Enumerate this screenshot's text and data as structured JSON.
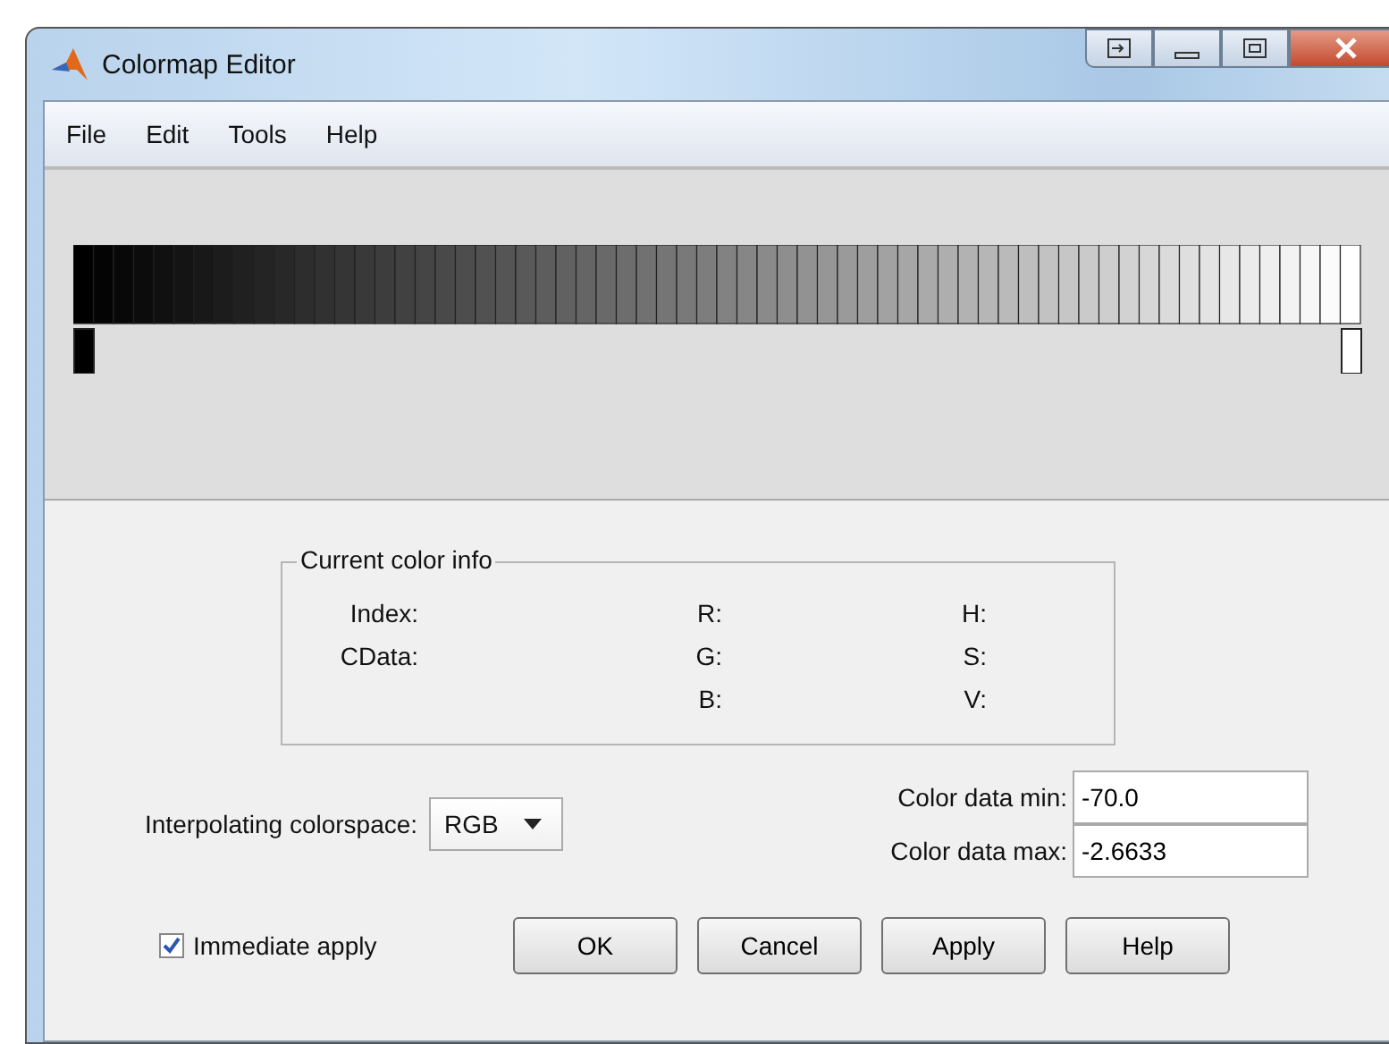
{
  "window": {
    "title": "Colormap Editor"
  },
  "menu": [
    "File",
    "Edit",
    "Tools",
    "Help"
  ],
  "color_info": {
    "title": "Current color info",
    "columns": [
      [
        "Index:",
        "CData:"
      ],
      [
        "R:",
        "G:",
        "B:"
      ],
      [
        "H:",
        "S:",
        "V:"
      ]
    ]
  },
  "colorspace": {
    "label": "Interpolating colorspace:",
    "value": "RGB"
  },
  "data_range": [
    {
      "label": "Color data min:",
      "value": "-70.0"
    },
    {
      "label": "Color data max:",
      "value": "-2.6633"
    }
  ],
  "immediate_apply": {
    "label": "Immediate apply",
    "checked": true
  },
  "buttons": [
    "OK",
    "Cancel",
    "Apply",
    "Help"
  ]
}
